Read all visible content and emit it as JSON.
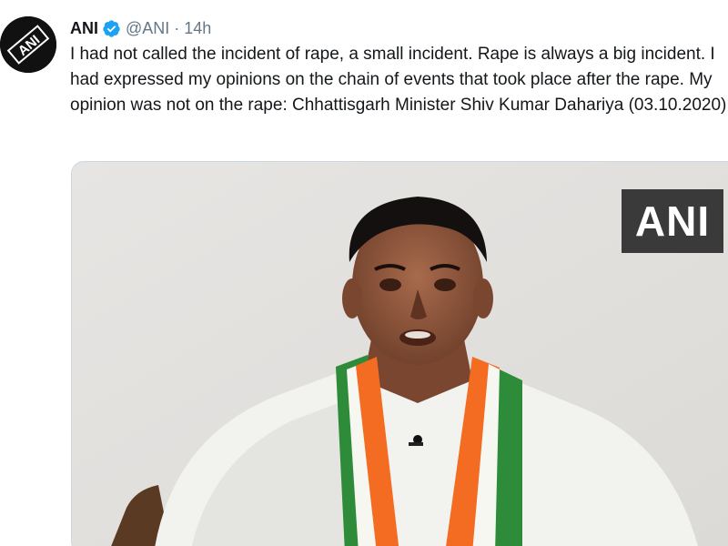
{
  "tweet": {
    "author_name": "ANI",
    "handle": "@ANI",
    "separator": "·",
    "time": "14h",
    "avatar_icon": "ani-logo-icon",
    "verified_icon": "verified-badge-icon",
    "text": "I had not called the incident of rape, a small incident. Rape is always a big incident. I had expressed my opinions on the chain of events that took place after the rape. My opinion was not on the rape: Chhattisgarh Minister Shiv Kumar Dahariya (03.10.2020)",
    "media": {
      "watermark": "ANI",
      "avatar_logo_text": "ANI"
    }
  },
  "colors": {
    "verified_blue": "#1da1f2",
    "secondary_text": "#657786",
    "primary_text": "#14171a",
    "saffron": "#f36c21",
    "green": "#2e8b3a"
  }
}
